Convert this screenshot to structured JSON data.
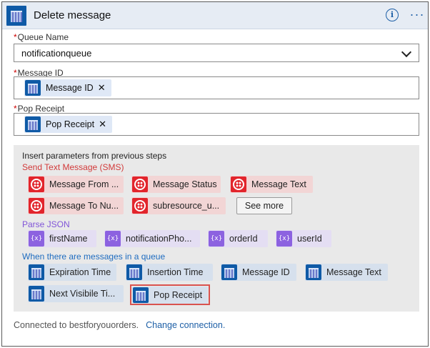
{
  "header": {
    "title": "Delete message",
    "info_icon": "info-icon",
    "more_icon": "more-icon"
  },
  "fields": {
    "queue_name": {
      "label": "Queue Name",
      "value": "notificationqueue",
      "required": true
    },
    "message_id": {
      "label": "Message ID",
      "token": "Message ID",
      "required": true
    },
    "pop_receipt": {
      "label": "Pop Receipt",
      "token": "Pop Receipt",
      "required": true
    }
  },
  "params_panel": {
    "title": "Insert parameters from previous steps",
    "sms": {
      "heading": "Send Text Message (SMS)",
      "chips": [
        "Message From ...",
        "Message Status",
        "Message Text",
        "Message To Nu...",
        "subresource_u..."
      ],
      "see_more": "See more"
    },
    "json": {
      "heading": "Parse JSON",
      "chips": [
        "firstName",
        "notificationPho...",
        "orderId",
        "userId"
      ]
    },
    "queue": {
      "heading": "When there are messages in a queue",
      "chips": [
        "Expiration Time",
        "Insertion Time",
        "Message ID",
        "Message Text",
        "Next Visibile Ti...",
        "Pop Receipt"
      ]
    }
  },
  "footer": {
    "connected_text": "Connected to bestforyouorders.",
    "change_link": "Change connection."
  },
  "colors": {
    "accent": "#1d5fa6",
    "required": "#cc0000",
    "highlight": "#d9534f"
  }
}
